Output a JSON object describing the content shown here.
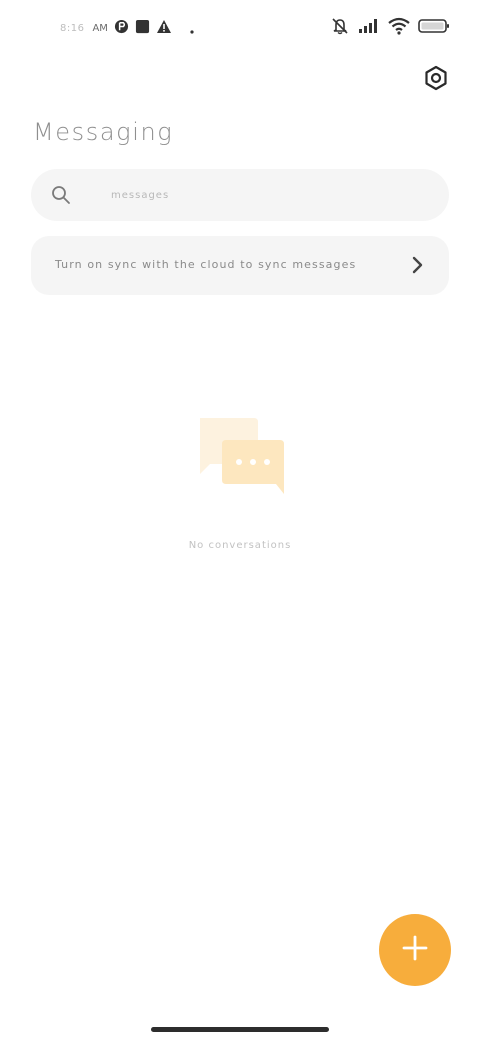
{
  "status_bar": {
    "time": "8:16",
    "ampm": "AM",
    "icons_left": [
      "app-notification-icon",
      "square-notification-icon",
      "warning-icon",
      "dot-icon"
    ],
    "icons_right": [
      "muted-bell-icon",
      "signal-icon",
      "wifi-icon",
      "battery-icon"
    ]
  },
  "header": {
    "title": "Messaging",
    "settings_icon": "settings-gear-icon"
  },
  "search": {
    "placeholder": "messages",
    "icon": "search-icon"
  },
  "sync_banner": {
    "text": "Turn on sync with the cloud to sync messages",
    "icon": "chevron-right-icon"
  },
  "empty_state": {
    "icon": "chat-bubbles-icon",
    "text": "No conversations"
  },
  "fab": {
    "icon": "plus-icon"
  },
  "colors": {
    "accent": "#f7ad3c",
    "card_bg": "#f5f5f5",
    "title": "#8f8f8f"
  }
}
